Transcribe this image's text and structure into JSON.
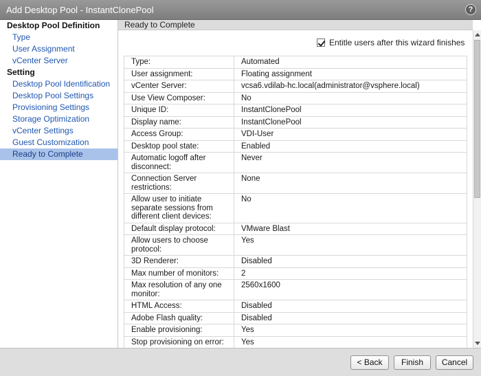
{
  "window": {
    "title": "Add Desktop Pool - InstantClonePool",
    "help_label": "?"
  },
  "sidebar": {
    "sections": [
      {
        "label": "Desktop Pool Definition",
        "items": [
          "Type",
          "User Assignment",
          "vCenter Server"
        ]
      },
      {
        "label": "Setting",
        "items": [
          "Desktop Pool Identification",
          "Desktop Pool Settings",
          "Provisioning Settings",
          "Storage Optimization",
          "vCenter Settings",
          "Guest Customization",
          "Ready to Complete"
        ]
      }
    ],
    "active_item": "Ready to Complete"
  },
  "main": {
    "header": "Ready to Complete",
    "entitle": {
      "checked": true,
      "label": "Entitle users after this wizard finishes"
    },
    "summary": [
      {
        "key": "Type:",
        "value": "Automated"
      },
      {
        "key": "User assignment:",
        "value": "Floating assignment"
      },
      {
        "key": "vCenter Server:",
        "value": "vcsa6.vdilab-hc.local(administrator@vsphere.local)"
      },
      {
        "key": "Use View Composer:",
        "value": "No"
      },
      {
        "key": "Unique ID:",
        "value": "InstantClonePool"
      },
      {
        "key": "Display name:",
        "value": "InstantClonePool"
      },
      {
        "key": "Access Group:",
        "value": "VDI-User"
      },
      {
        "key": "Desktop pool state:",
        "value": "Enabled"
      },
      {
        "key": "Automatic logoff after disconnect:",
        "value": "Never"
      },
      {
        "key": "Connection Server restrictions:",
        "value": "None"
      },
      {
        "key": "Allow user to initiate separate sessions from different client devices:",
        "value": "No"
      },
      {
        "key": "Default display protocol:",
        "value": "VMware Blast"
      },
      {
        "key": "Allow users to choose protocol:",
        "value": "Yes"
      },
      {
        "key": "3D Renderer:",
        "value": "Disabled"
      },
      {
        "key": "Max number of monitors:",
        "value": "2"
      },
      {
        "key": "Max resolution of any one monitor:",
        "value": "2560x1600"
      },
      {
        "key": "HTML Access:",
        "value": "Disabled"
      },
      {
        "key": "Adobe Flash quality:",
        "value": "Disabled"
      },
      {
        "key": "Enable provisioning:",
        "value": "Yes"
      },
      {
        "key": "Stop provisioning on error:",
        "value": "Yes"
      }
    ]
  },
  "footer": {
    "back_label": "< Back",
    "finish_label": "Finish",
    "cancel_label": "Cancel"
  }
}
